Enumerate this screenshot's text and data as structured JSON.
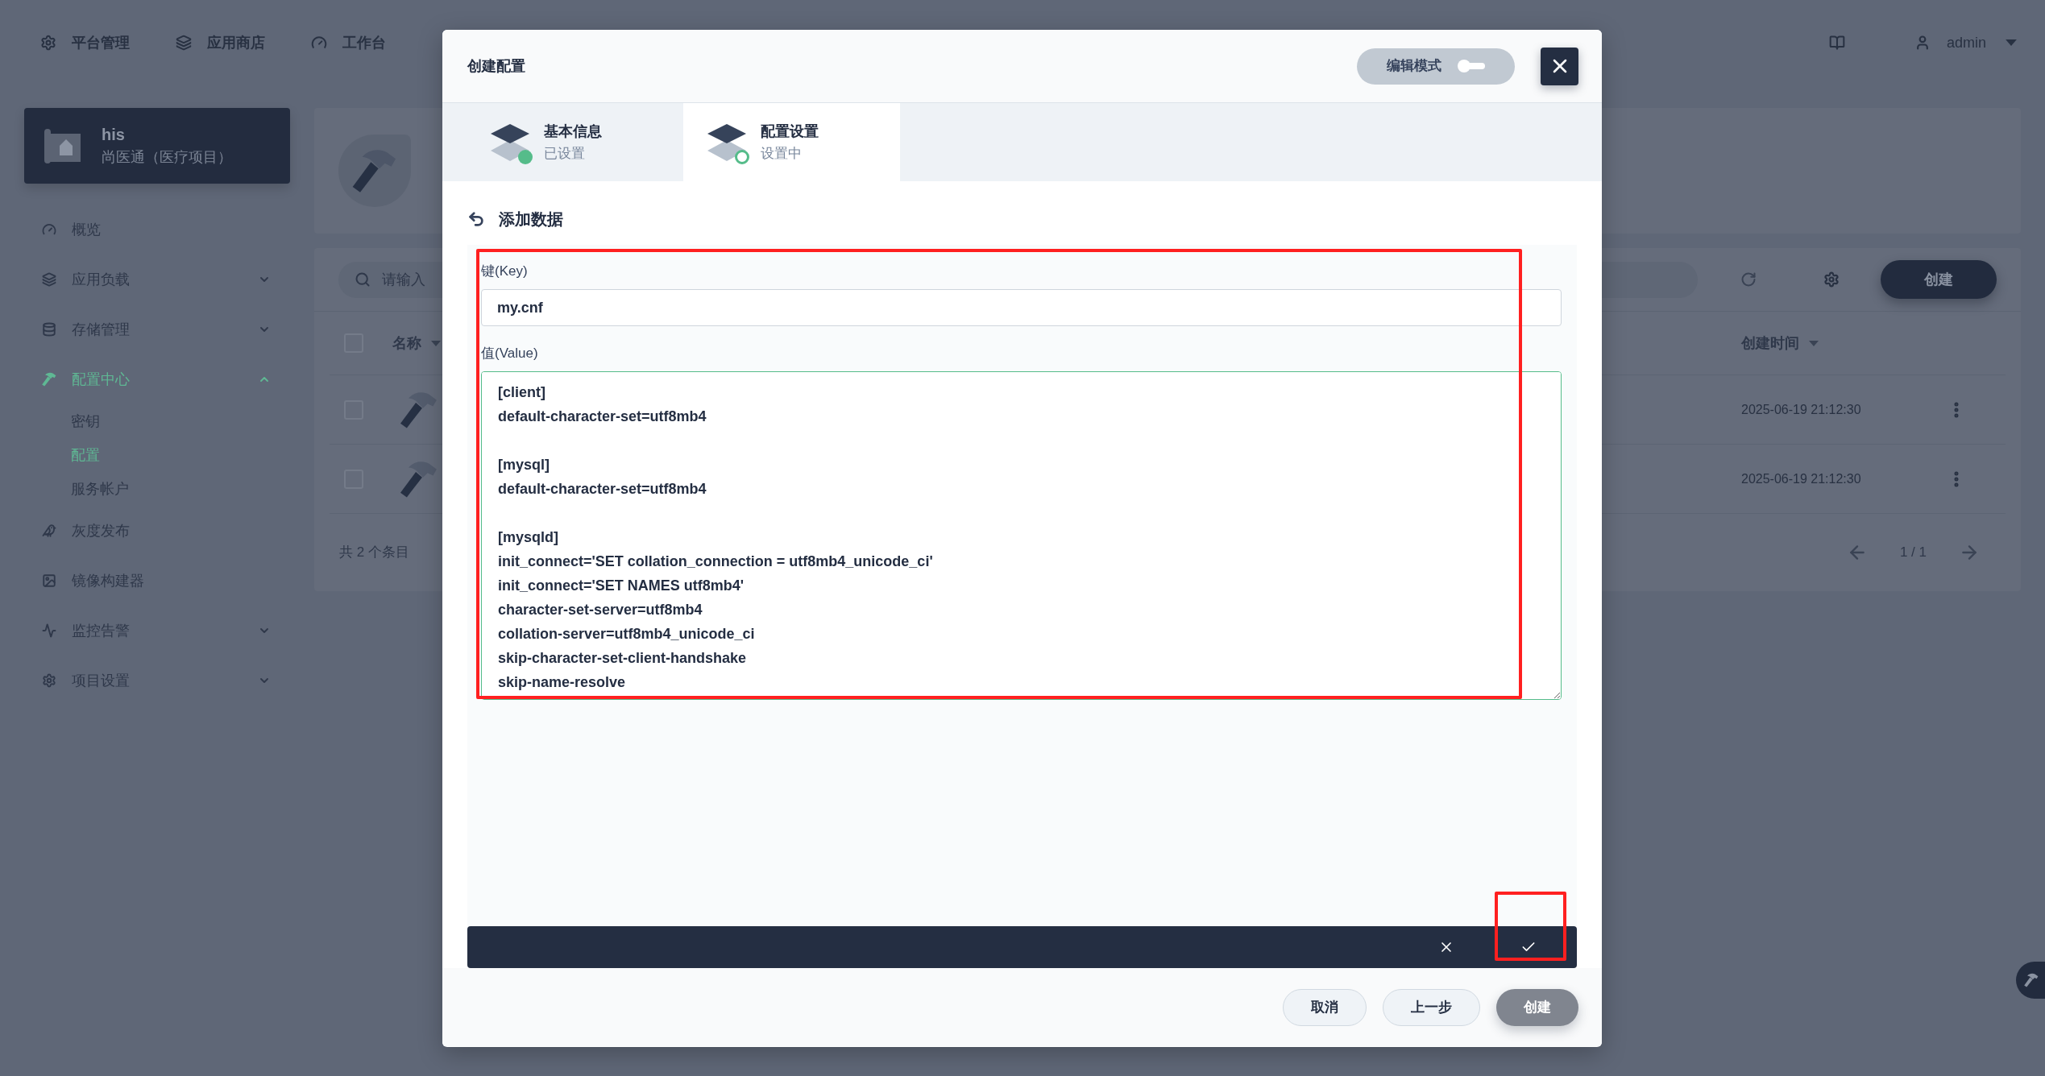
{
  "top_nav": {
    "items": [
      {
        "label": "平台管理"
      },
      {
        "label": "应用商店"
      },
      {
        "label": "工作台"
      }
    ],
    "user": {
      "name": "admin"
    }
  },
  "sidebar": {
    "project": {
      "name": "his",
      "description": "尚医通（医疗项目）"
    },
    "items": [
      {
        "label": "概览",
        "kind": "link",
        "selected": false
      },
      {
        "label": "应用负载",
        "kind": "group",
        "selected": false,
        "expanded": false
      },
      {
        "label": "存储管理",
        "kind": "group",
        "selected": false,
        "expanded": false
      },
      {
        "label": "配置中心",
        "kind": "group",
        "selected": true,
        "expanded": true,
        "children": [
          {
            "label": "密钥",
            "selected": false
          },
          {
            "label": "配置",
            "selected": true
          },
          {
            "label": "服务帐户",
            "selected": false
          }
        ]
      },
      {
        "label": "灰度发布",
        "kind": "link",
        "selected": false
      },
      {
        "label": "镜像构建器",
        "kind": "link",
        "selected": false
      },
      {
        "label": "监控告警",
        "kind": "group",
        "selected": false,
        "expanded": false
      },
      {
        "label": "项目设置",
        "kind": "group",
        "selected": false,
        "expanded": false
      }
    ]
  },
  "content": {
    "toolbar": {
      "search": {
        "placeholder": "请输入"
      },
      "create_button": "创建"
    },
    "table": {
      "select_all": {
        "checked": false
      },
      "columns": [
        {
          "label": "名称"
        },
        {
          "label": "创建时间"
        }
      ],
      "rows": [
        {
          "checked": false,
          "created": "2025-06-19 21:12:30"
        },
        {
          "checked": false,
          "created": "2025-06-19 21:12:30"
        }
      ],
      "footer": "共 2 个条目",
      "pagination": "1 / 1"
    }
  },
  "modal": {
    "title": "创建配置",
    "edit_mode": {
      "label": "编辑模式",
      "on": false
    },
    "steps": [
      {
        "title": "基本信息",
        "status": "已设置",
        "selected": false,
        "done": true
      },
      {
        "title": "配置设置",
        "status": "设置中",
        "selected": true,
        "done": false
      }
    ],
    "section_title": "添加数据",
    "form": {
      "key": {
        "label": "键(Key)",
        "value": "my.cnf"
      },
      "value": {
        "label": "值(Value)",
        "value": "[client]\ndefault-character-set=utf8mb4\n\n[mysql]\ndefault-character-set=utf8mb4\n\n[mysqld]\ninit_connect='SET collation_connection = utf8mb4_unicode_ci'\ninit_connect='SET NAMES utf8mb4'\ncharacter-set-server=utf8mb4\ncollation-server=utf8mb4_unicode_ci\nskip-character-set-client-handshake\nskip-name-resolve",
        "focused": true
      }
    },
    "buttons": [
      {
        "label": "取消",
        "kind": "secondary",
        "disabled": false
      },
      {
        "label": "上一步",
        "kind": "secondary",
        "disabled": false
      },
      {
        "label": "创建",
        "kind": "primary",
        "disabled": true
      }
    ]
  }
}
